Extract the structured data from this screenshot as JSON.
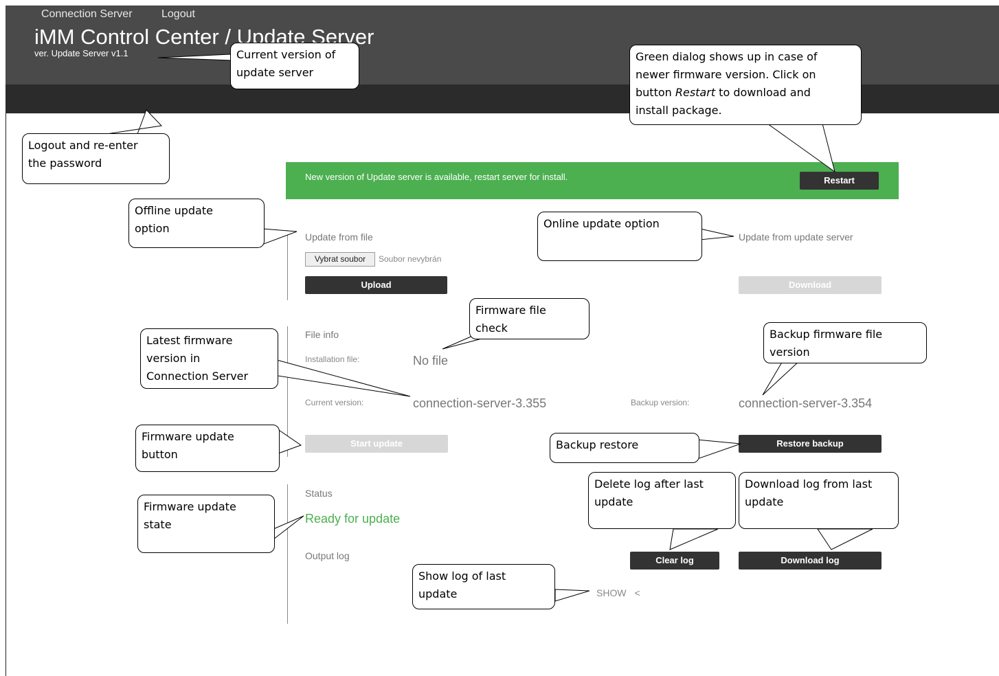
{
  "header": {
    "title": "iMM Control Center / Update Server",
    "version": "ver. Update Server v1.1"
  },
  "nav": {
    "items": [
      "Connection Server",
      "Logout"
    ]
  },
  "banner": {
    "message": "New version of Update server is available, restart server for install.",
    "restart_label": "Restart",
    "color": "#4caf50"
  },
  "offline": {
    "heading": "Update from file",
    "choose_file_label": "Vybrat soubor",
    "no_file_chosen": "Soubor nevybrán",
    "upload_label": "Upload"
  },
  "online": {
    "heading": "Update from update server",
    "download_label": "Download"
  },
  "file_info": {
    "heading": "File info",
    "installation_label": "Installation file:",
    "installation_value": "No file",
    "current_label": "Current version:",
    "current_value": "connection-server-3.355",
    "backup_label": "Backup version:",
    "backup_value": "connection-server-3.354",
    "start_update_label": "Start update",
    "restore_label": "Restore backup"
  },
  "status": {
    "heading": "Status",
    "value": "Ready for update",
    "output_log_label": "Output log",
    "clear_log_label": "Clear log",
    "download_log_label": "Download log",
    "show_label": "SHOW",
    "show_icon": "<"
  },
  "callouts": {
    "current_version": "Current version of\nupdate server",
    "green_dialog": "Green dialog shows up in case of\nnewer firmware version. Click on\nbutton Restart to download and\ninstall package.",
    "logout": "Logout and re-enter\nthe password",
    "offline": "Offline update\noption",
    "online": "Online update option",
    "firmware_check": "Firmware file\ncheck",
    "latest_firmware": "Latest firmware\nversion in\nConnection Server",
    "backup_file": "Backup firmware file\nversion",
    "update_button": "Firmware update\nbutton",
    "backup_restore": "Backup restore",
    "update_state": "Firmware update\nstate",
    "delete_log": "Delete log after last\nupdate",
    "download_log": "Download log from last\nupdate",
    "show_log": "Show log of last\nupdate"
  }
}
